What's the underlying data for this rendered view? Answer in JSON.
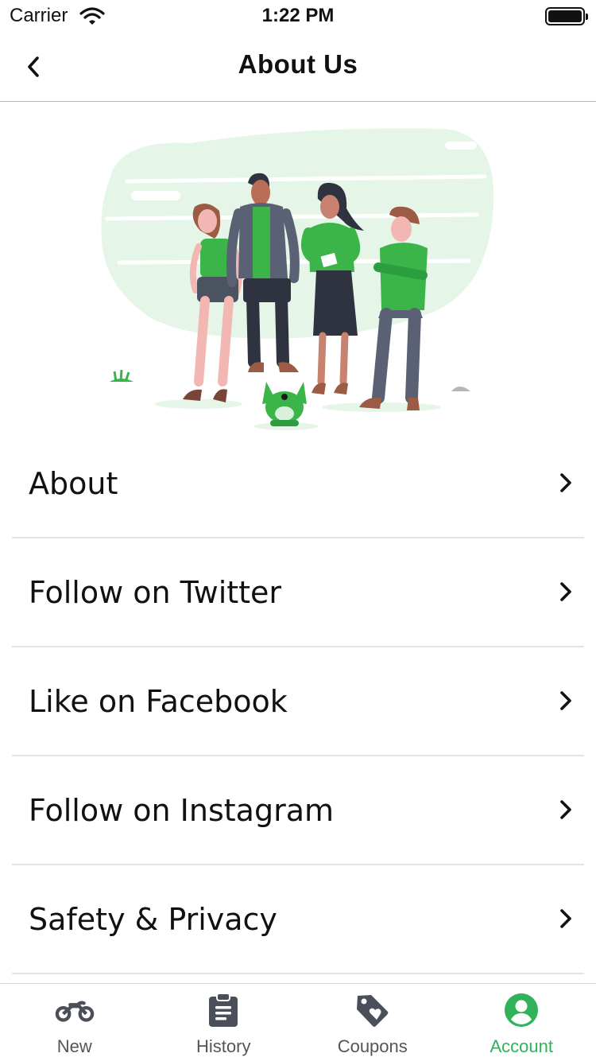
{
  "status_bar": {
    "carrier": "Carrier",
    "time": "1:22 PM"
  },
  "header": {
    "title": "About Us",
    "back_icon": "chevron-left-icon"
  },
  "hero": {
    "illustration": "team-illustration",
    "accent_color": "#3bb54a",
    "background_blob_color": "#e5f5e7"
  },
  "menu": {
    "items": [
      {
        "label": "About"
      },
      {
        "label": "Follow on Twitter"
      },
      {
        "label": "Like on Facebook"
      },
      {
        "label": "Follow on Instagram"
      },
      {
        "label": "Safety & Privacy"
      }
    ],
    "chevron_icon": "chevron-right-icon"
  },
  "tab_bar": {
    "tabs": [
      {
        "label": "New",
        "icon": "motorcycle-icon"
      },
      {
        "label": "History",
        "icon": "clipboard-icon"
      },
      {
        "label": "Coupons",
        "icon": "tag-heart-icon"
      },
      {
        "label": "Account",
        "icon": "account-icon",
        "active": true
      }
    ],
    "active_color": "#2fb25a",
    "inactive_color": "#555555"
  }
}
